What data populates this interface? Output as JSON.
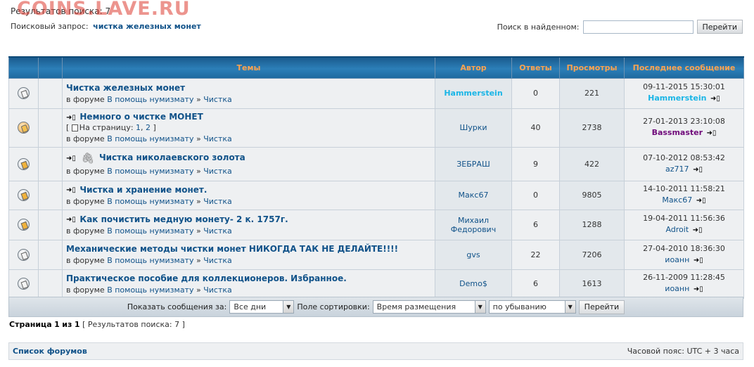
{
  "watermark": "COINS.LAVE.RU",
  "results_title": "Результатов поиска: 7",
  "query": {
    "label": "Поисковый запрос:",
    "value": "чистка железных монет"
  },
  "search_in_results": {
    "label": "Поиск в найденном:",
    "button": "Перейти",
    "value": ""
  },
  "columns": [
    "Темы",
    "Автор",
    "Ответы",
    "Просмотры",
    "Последнее сообщение"
  ],
  "forum_prefix": "в форуме",
  "forum_name": "В помощь нумизмату",
  "subforum_sep": "»",
  "subforum": "Чистка",
  "topics": [
    {
      "icon": "topic-read-icon",
      "new": false,
      "attach": false,
      "title": "Чистка железных монет",
      "pages": null,
      "author": "Hammerstein",
      "replies": "0",
      "views": "221",
      "last_date": "09-11-2015 15:30:01",
      "last_author": "Hammerstein"
    },
    {
      "icon": "topic-locked-icon",
      "new": true,
      "attach": false,
      "title": "Немного о чистке МОНЕТ",
      "pages": {
        "prefix": "[",
        "label": "На страницу:",
        "p1": "1",
        "sep": ",",
        "p2": "2",
        "suffix": "]"
      },
      "author": "Шурки",
      "replies": "40",
      "views": "2738",
      "last_date": "27-01-2013 23:10:08",
      "last_author": "Bassmaster"
    },
    {
      "icon": "topic-hot-icon",
      "new": true,
      "attach": true,
      "title": "Чистка николаевского золота",
      "pages": null,
      "author": "ЗЕБРАШ",
      "replies": "9",
      "views": "422",
      "last_date": "07-10-2012 08:53:42",
      "last_author": "az717"
    },
    {
      "icon": "topic-hot-icon",
      "new": true,
      "attach": false,
      "title": "Чистка и хранение монет.",
      "pages": null,
      "author": "Макс67",
      "replies": "0",
      "views": "9805",
      "last_date": "14-10-2011 11:58:21",
      "last_author": "Макс67"
    },
    {
      "icon": "topic-hot-icon",
      "new": true,
      "attach": false,
      "title": "Как почистить медную монету- 2 к. 1757г.",
      "pages": null,
      "author": "Михаил Федорович",
      "replies": "6",
      "views": "1288",
      "last_date": "19-04-2011 11:56:36",
      "last_author": "Adroit"
    },
    {
      "icon": "topic-read-icon",
      "new": false,
      "attach": false,
      "title": "Механические методы чистки монет НИКОГДА ТАК НЕ ДЕЛАЙТЕ!!!!",
      "pages": null,
      "author": "gvs",
      "replies": "22",
      "views": "7206",
      "last_date": "27-04-2010 18:36:30",
      "last_author": "иоанн"
    },
    {
      "icon": "topic-read-icon",
      "new": false,
      "attach": false,
      "title": "Практическое пособие для коллекционеров. Избранное.",
      "pages": null,
      "author": "Demo$",
      "replies": "6",
      "views": "1613",
      "last_date": "26-11-2009 11:28:45",
      "last_author": "иоанн"
    }
  ],
  "sortbar": {
    "show_label": "Показать сообщения за:",
    "show_value": "Все дни",
    "sort_label": "Поле сортировки:",
    "sort_value": "Время размещения",
    "order_value": "по убыванию",
    "button": "Перейти"
  },
  "pagination": {
    "page": "Страница",
    "current": "1",
    "of": "из",
    "total": "1",
    "results": "[ Результатов поиска: 7 ]"
  },
  "footer": {
    "forum_list": "Список форумов",
    "timezone": "Часовой пояс: UTC + 3 часа"
  },
  "colors": {
    "header_text": "#ffa34f",
    "link": "#105289",
    "highlight_author": "#1ab5e6",
    "purple_author": "#6f0a7a"
  }
}
